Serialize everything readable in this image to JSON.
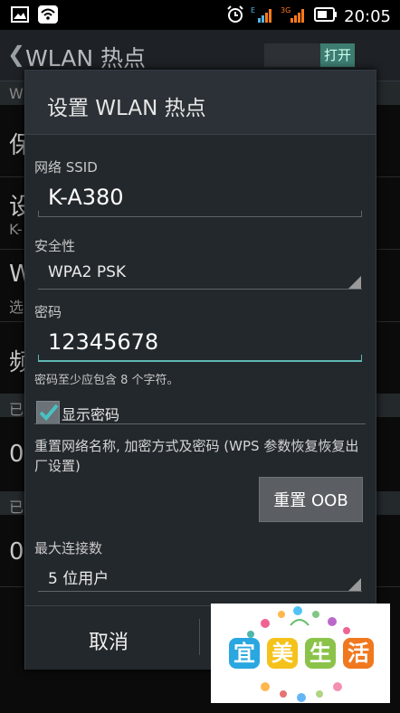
{
  "status_bar": {
    "time": "20:05",
    "net_e": "E",
    "net_3g": "3G"
  },
  "background": {
    "title": "WLAN 热点",
    "switch_label": "打开",
    "letters": [
      "W",
      "保",
      "设",
      "K-",
      "W",
      "选",
      "频",
      "已",
      "0",
      "已",
      "0"
    ]
  },
  "dialog": {
    "title": "设置 WLAN 热点",
    "ssid_label": "网络 SSID",
    "ssid_value": "K-A380",
    "security_label": "安全性",
    "security_value": "WPA2 PSK",
    "password_label": "密码",
    "password_value": "12345678",
    "password_hint": "密码至少应包含 8 个字符。",
    "show_password_label": "显示密码",
    "show_password_checked": true,
    "reset_description": "重置网络名称, 加密方式及密码 (WPS 参数恢复恢复出厂设置)",
    "reset_button": "重置 OOB",
    "max_conn_label": "最大连接数",
    "max_conn_value": "5 位用户",
    "cancel_button": "取消"
  },
  "watermark": {
    "text": [
      "宜",
      "美",
      "生",
      "活"
    ],
    "colors": [
      "#2aa7e0",
      "#f4c21b",
      "#8bc34a",
      "#f0781e"
    ]
  },
  "colors": {
    "accent": "#5fb7b4",
    "dialog_bg": "#23282d",
    "header_bg": "#2b3136"
  }
}
